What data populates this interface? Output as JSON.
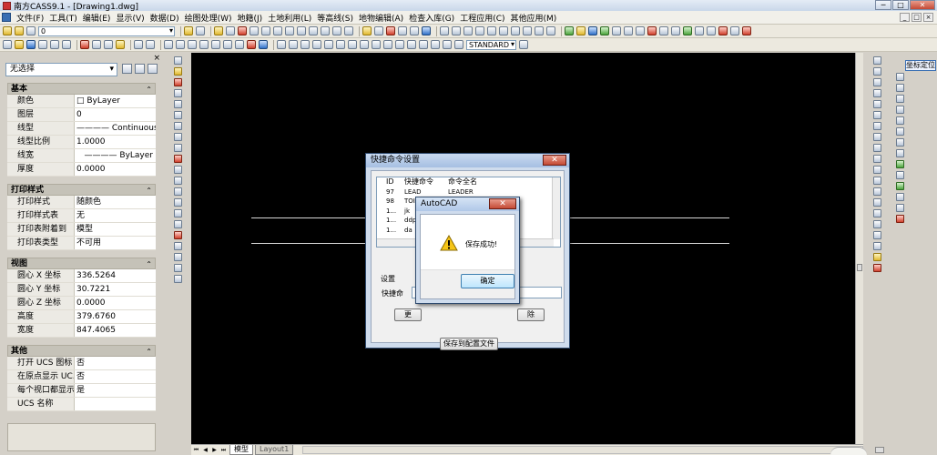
{
  "window": {
    "title": "南方CASS9.1 - [Drawing1.dwg]",
    "min_label": "─",
    "max_label": "□",
    "close_label": "✕"
  },
  "menubar": {
    "items": [
      "文件(F)",
      "工具(T)",
      "编辑(E)",
      "显示(V)",
      "数据(D)",
      "绘图处理(W)",
      "地籍(J)",
      "土地利用(L)",
      "等高线(S)",
      "地物编辑(A)",
      "检查入库(G)",
      "工程应用(C)",
      "其他应用(M)"
    ],
    "doc_min": "_",
    "doc_restore": "□",
    "doc_close": "×"
  },
  "toolbar": {
    "layer_value": "0",
    "text_style": "STANDARD"
  },
  "properties": {
    "close_glyph": "×",
    "selection": "无选择",
    "sections": [
      {
        "title": "基本",
        "toggle": "⌃",
        "rows": [
          {
            "name": "颜色",
            "value": "□ ByLayer"
          },
          {
            "name": "图层",
            "value": "0"
          },
          {
            "name": "线型",
            "value": "———— Continuous"
          },
          {
            "name": "线型比例",
            "value": "1.0000"
          },
          {
            "name": "线宽",
            "value": "———— ByLayer"
          },
          {
            "name": "厚度",
            "value": "0.0000"
          }
        ]
      },
      {
        "title": "打印样式",
        "toggle": "⌃",
        "rows": [
          {
            "name": "打印样式",
            "value": "随颜色"
          },
          {
            "name": "打印样式表",
            "value": "无"
          },
          {
            "name": "打印表附着到",
            "value": "模型"
          },
          {
            "name": "打印表类型",
            "value": "不可用"
          }
        ]
      },
      {
        "title": "视图",
        "toggle": "⌃",
        "rows": [
          {
            "name": "圆心 X 坐标",
            "value": "336.5264"
          },
          {
            "name": "圆心 Y 坐标",
            "value": "30.7221"
          },
          {
            "name": "圆心 Z 坐标",
            "value": "0.0000"
          },
          {
            "name": "高度",
            "value": "379.6760"
          },
          {
            "name": "宽度",
            "value": "847.4065"
          }
        ]
      },
      {
        "title": "其他",
        "toggle": "⌃",
        "rows": [
          {
            "name": "打开 UCS 图标",
            "value": "否"
          },
          {
            "name": "在原点显示 UC...",
            "value": "否"
          },
          {
            "name": "每个视口都显示...",
            "value": "是"
          },
          {
            "name": "UCS 名称",
            "value": ""
          }
        ]
      }
    ]
  },
  "right_panel": {
    "coord_tab": "坐标定位"
  },
  "layout_tabs": {
    "nav": [
      "⏮",
      "◀",
      "▶",
      "⏭"
    ],
    "model": "模型",
    "layout1": "Layout1"
  },
  "shortcut_dialog": {
    "title": "快捷命令设置",
    "close_label": "✕",
    "columns": [
      "ID",
      "快捷命令",
      "命令全名"
    ],
    "rows": [
      {
        "id": "97",
        "short": "LEAD",
        "full": "LEADER"
      },
      {
        "id": "98",
        "short": "TOI",
        "full": ""
      },
      {
        "id": "1...",
        "short": "jk",
        "full": ""
      },
      {
        "id": "1...",
        "short": "ddp",
        "full": ""
      },
      {
        "id": "1...",
        "short": "da",
        "full": ""
      }
    ],
    "group_label": "设置",
    "field_label": "快捷命",
    "modify_label": "更",
    "delete_label": "除",
    "save_label": "保存到配置文件"
  },
  "alert_dialog": {
    "title": "AutoCAD",
    "close_label": "✕",
    "message": "保存成功!",
    "ok_label": "确定"
  }
}
